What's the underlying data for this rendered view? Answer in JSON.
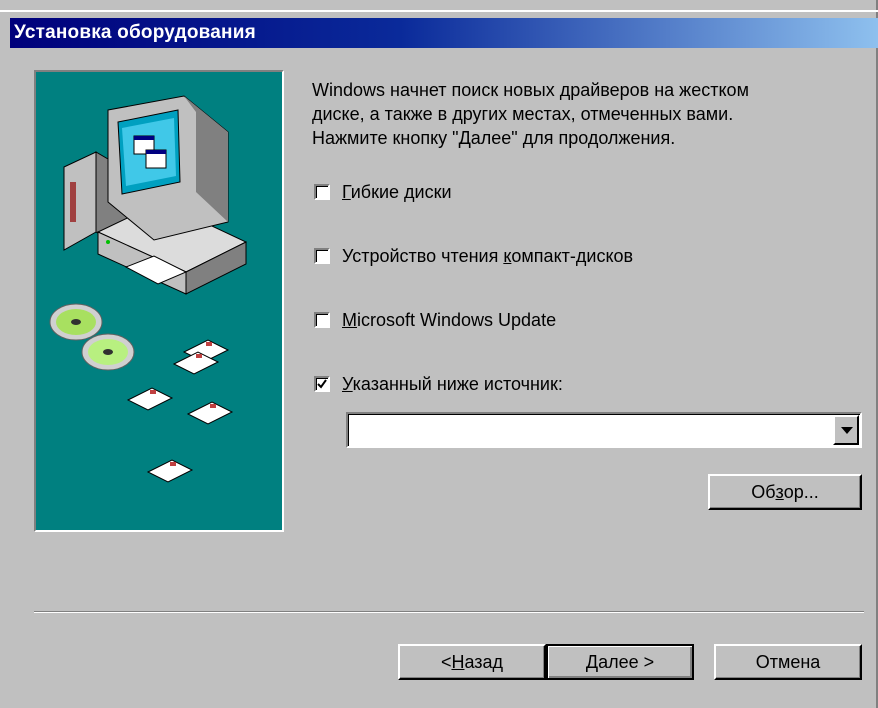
{
  "window": {
    "title": "Установка оборудования"
  },
  "description": {
    "line1": "Windows начнет поиск новых драйверов на жестком",
    "line2": "диске, а также в других местах, отмеченных вами.",
    "line3": "Нажмите кнопку \"Далее\" для продолжения."
  },
  "options": [
    {
      "pre": "",
      "key": "Г",
      "post": "ибкие диски",
      "checked": false
    },
    {
      "pre": "Устройство чтения ",
      "key": "к",
      "post": "омпакт-дисков",
      "checked": false
    },
    {
      "pre": "",
      "key": "M",
      "post": "icrosoft Windows Update",
      "checked": false
    },
    {
      "pre": "",
      "key": "У",
      "post": "казанный ниже источник:",
      "checked": true
    }
  ],
  "source_combo": {
    "value": ""
  },
  "browse_button": {
    "pre": "Об",
    "key": "з",
    "post": "ор..."
  },
  "buttons": {
    "back_pre": "< ",
    "back_key": "Н",
    "back_post": "азад",
    "next": "Далее >",
    "cancel": "Отмена"
  },
  "icons": {
    "computer": "computer-illustration-icon",
    "cds": "cd-disc-icon",
    "floppies": "floppy-disk-icon",
    "check": "check-mark-icon",
    "dropdown": "dropdown-arrow-icon"
  }
}
